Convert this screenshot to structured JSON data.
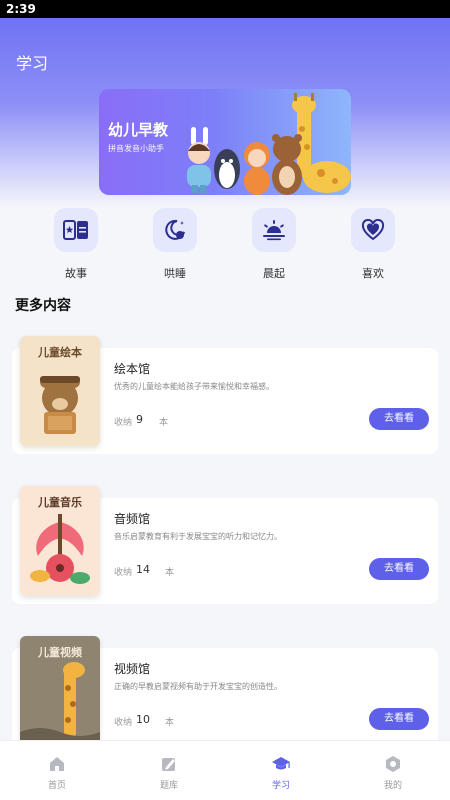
{
  "status": {
    "time": "2:39"
  },
  "header": {
    "title": "学习"
  },
  "banner": {
    "title": "幼儿早教",
    "subtitle": "拼音发音小助手"
  },
  "features": [
    {
      "label": "故事",
      "icon": "story-book-icon"
    },
    {
      "label": "哄睡",
      "icon": "moon-icon"
    },
    {
      "label": "晨起",
      "icon": "sunrise-icon"
    },
    {
      "label": "喜欢",
      "icon": "heart-icon"
    }
  ],
  "section": {
    "title": "更多内容"
  },
  "cards": [
    {
      "thumb_title": "儿童绘本",
      "name": "绘本馆",
      "desc": "优秀的儿童绘本能给孩子带来愉悦和幸福感。",
      "count_label": "收纳",
      "count": "9",
      "unit": "本",
      "button": "去看看"
    },
    {
      "thumb_title": "儿童音乐",
      "name": "音频馆",
      "desc": "音乐启蒙教育有利于发展宝宝的听力和记忆力。",
      "count_label": "收纳",
      "count": "14",
      "unit": "本",
      "button": "去看看"
    },
    {
      "thumb_title": "儿童视频",
      "name": "视频馆",
      "desc": "正确的早教启蒙视频有助于开发宝宝的创造性。",
      "count_label": "收纳",
      "count": "10",
      "unit": "本",
      "button": "去看看"
    }
  ],
  "tabs": [
    {
      "label": "首页",
      "icon": "home-icon"
    },
    {
      "label": "题库",
      "icon": "edit-icon"
    },
    {
      "label": "学习",
      "icon": "graduation-cap-icon",
      "active": true
    },
    {
      "label": "我的",
      "icon": "profile-icon"
    }
  ],
  "colors": {
    "accent": "#5e60ea",
    "icon_bg": "#e5e7fc"
  }
}
